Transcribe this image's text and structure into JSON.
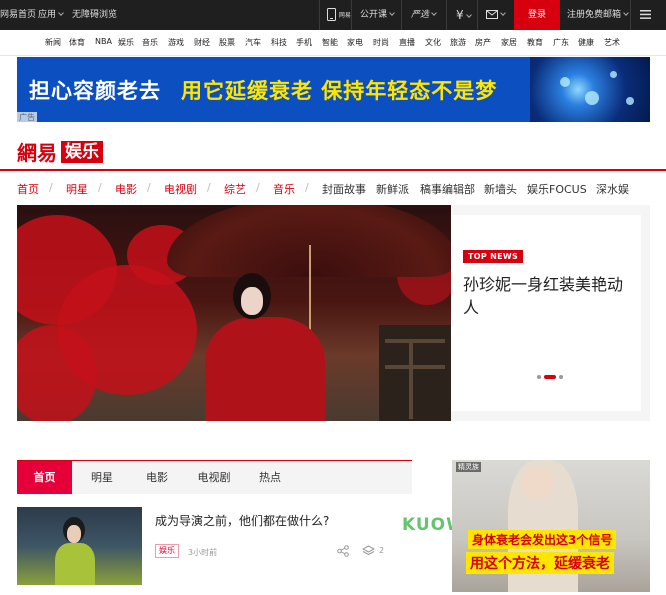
{
  "topbar": {
    "home": "网易首页",
    "apps": "应用",
    "browser": "无障碍浏览",
    "phone_label": "网易",
    "open_course": "公开课",
    "yanxuan": "严选",
    "currency": "¥",
    "login": "登录",
    "register": "注册免费邮箱"
  },
  "channels": [
    "新闻",
    "体育",
    "NBA",
    "娱乐",
    "音乐",
    "游戏",
    "财经",
    "股票",
    "汽车",
    "科技",
    "手机",
    "智能",
    "家电",
    "时尚",
    "直播",
    "文化",
    "旅游",
    "房产",
    "家居",
    "教育",
    "广东",
    "健康",
    "艺术"
  ],
  "ad_banner": {
    "text_white": "担心容颜老去",
    "text_yellow": "用它延缓衰老 保持年轻态不是梦",
    "tag": "广告"
  },
  "logo": {
    "site": "網易",
    "channel": "娱乐"
  },
  "main_nav": {
    "red_items": [
      "首页",
      "明星",
      "电影",
      "电视剧",
      "综艺",
      "音乐"
    ],
    "black_items": [
      "封面故事",
      "新鲜派",
      "稿事编辑部",
      "新墙头",
      "娱乐FOCUS",
      "深水娱"
    ]
  },
  "hero": {
    "badge": "TOP NEWS",
    "title": "孙珍妮一身红装美艳动人",
    "slide_count": 3,
    "active_slide": 2
  },
  "tabs": [
    "首页",
    "明星",
    "电影",
    "电视剧",
    "热点"
  ],
  "article": {
    "title": "成为导演之前，他们都在做什么?",
    "tag": "娱乐",
    "time": "3小时前",
    "comments": "2"
  },
  "watermark": "KUOWEE.COM",
  "side_ad": {
    "tag": "精灵族",
    "line1": "身体衰老会发出这3个信号",
    "line2": "用这个方法，延缓衰老"
  },
  "colors": {
    "brand_red": "#d6000f",
    "tab_active": "#e6003a",
    "ad_blue": "#0b4fc0",
    "ad_yellow": "#ffe600",
    "topbar": "#1f1f1f"
  },
  "icons": [
    "chevron-down-icon",
    "phone-icon",
    "mail-icon",
    "menu-icon",
    "share-icon",
    "stack-icon"
  ]
}
